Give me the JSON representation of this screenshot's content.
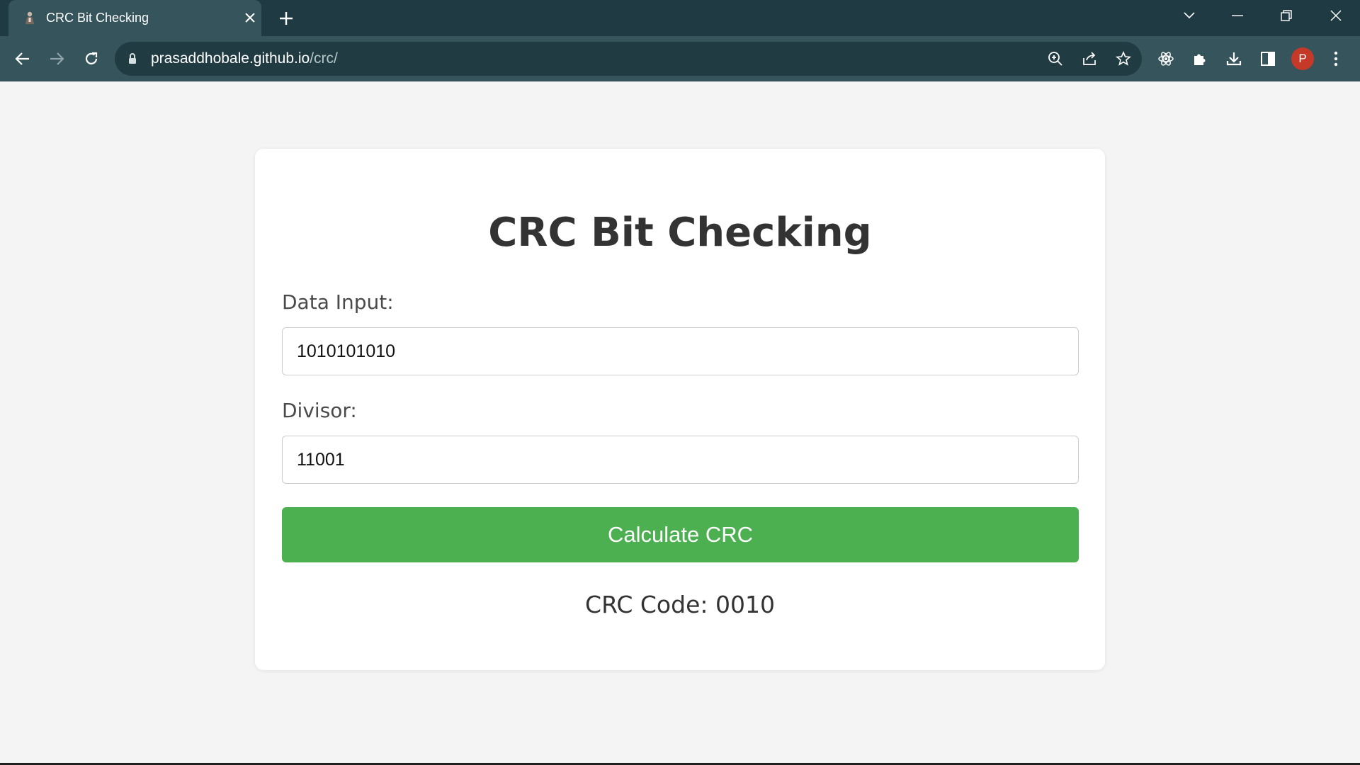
{
  "browser": {
    "tab_title": "CRC Bit Checking",
    "url_host": "prasaddhobale.github.io",
    "url_path": "/crc/",
    "profile_initial": "P",
    "colors": {
      "frame": "#1f3a42",
      "toolbar": "#35545c",
      "omnibox": "#203b42",
      "avatar": "#c53929"
    }
  },
  "page": {
    "title": "CRC Bit Checking",
    "data_input_label": "Data Input:",
    "data_input_value": "1010101010",
    "divisor_label": "Divisor:",
    "divisor_value": "11001",
    "calculate_label": "Calculate CRC",
    "result_text": "CRC Code: 0010",
    "colors": {
      "button": "#4caf50",
      "background": "#f4f4f4",
      "card": "#ffffff"
    }
  }
}
